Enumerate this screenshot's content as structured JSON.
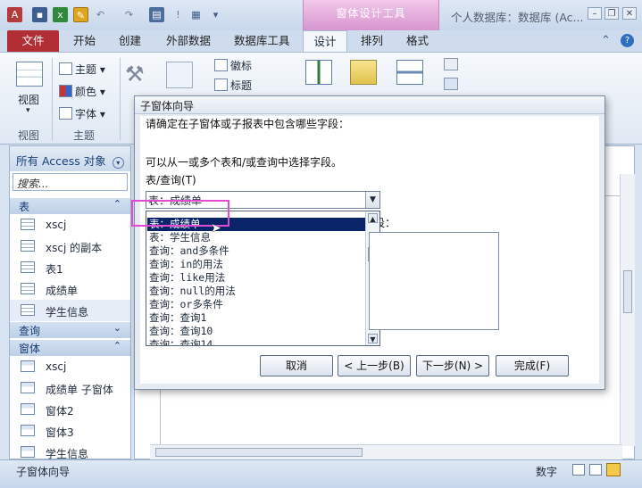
{
  "titlebar": {
    "context_tool": "窗体设计工具",
    "app_title": "个人数据库：数据库 (Ac..."
  },
  "ribbon_tabs": [
    "文件",
    "开始",
    "创建",
    "外部数据",
    "数据库工具",
    "设计",
    "排列",
    "格式"
  ],
  "ribbon": {
    "view_label": "视图",
    "view_group": "视图",
    "theme_group": "主题",
    "theme": "主题",
    "color": "颜色",
    "font": "字体",
    "logo": "徽标",
    "title": "标题"
  },
  "nav": {
    "header": "所有 Access 对象",
    "search_placeholder": "搜索...",
    "sections": {
      "tables": "表",
      "queries": "查询",
      "forms": "窗体"
    },
    "tables": [
      "xscj",
      "xscj 的副本",
      "表1",
      "成绩单",
      "学生信息"
    ],
    "forms": [
      "xscj",
      "成绩单 子窗体",
      "窗体2",
      "窗体3",
      "学生信息"
    ]
  },
  "wizard": {
    "title": "子窗体向导",
    "question": "请确定在子窗体或子报表中包含哪些字段：",
    "hint": "可以从一或多个表和/或查询中选择字段。",
    "table_query_label": "表/查询(T)",
    "combo_value": "表：成绩单",
    "fields_label": "段：",
    "list_items": [
      "表：成绩单",
      "表：学生信息",
      "查询：and多条件",
      "查询：in的用法",
      "查询：like用法",
      "查询：null的用法",
      "查询：or多条件",
      "查询：查询1",
      "查询：查询10",
      "查询：查询14"
    ],
    "buttons": {
      "cancel": "取消",
      "back": "< 上一步(B)",
      "next": "下一步(N) >",
      "finish": "完成(F)"
    }
  },
  "status": {
    "left": "子窗体向导",
    "right": "数字"
  },
  "colors": {
    "file_tab": "#b22e35",
    "context_tab": "#d795cf",
    "list_selection": "#0a246a",
    "highlight": "#e34ad3"
  }
}
